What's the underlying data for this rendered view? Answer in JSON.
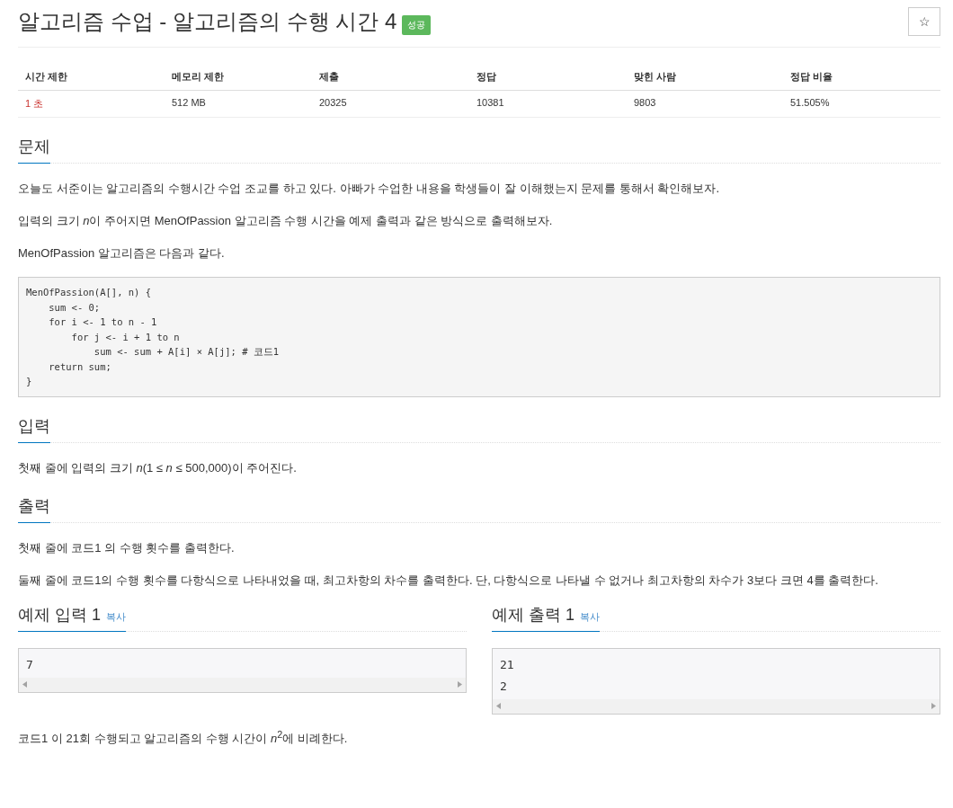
{
  "title": "알고리즘 수업 - 알고리즘의 수행 시간 4",
  "badge": "성공",
  "star_button": "☆",
  "info_table": {
    "columns": [
      "시간 제한",
      "메모리 제한",
      "제출",
      "정답",
      "맞힌 사람",
      "정답 비율"
    ],
    "row": [
      "1 초",
      "512 MB",
      "20325",
      "10381",
      "9803",
      "51.505%"
    ]
  },
  "sections": [
    {
      "heading": "문제",
      "blocks": [
        {
          "kind": "text",
          "text": "오늘도 서준이는 알고리즘의 수행시간 수업 조교를 하고 있다. 아빠가 수업한 내용을 학생들이 잘 이해했는지 문제를 통해서 확인해보자."
        },
        {
          "kind": "runs",
          "runs": [
            {
              "text": "입력의 크기 ",
              "italic": false
            },
            {
              "text": "n",
              "italic": true
            },
            {
              "text": "이 주어지면 MenOfPassion 알고리즘 수행 시간을 예제 출력과 같은 방식으로 출력해보자.",
              "italic": false
            }
          ]
        },
        {
          "kind": "text",
          "text": "MenOfPassion 알고리즘은 다음과 같다."
        },
        {
          "kind": "code",
          "lines": [
            "MenOfPassion(A[], n) {",
            "    sum <- 0;",
            "    for i <- 1 to n - 1",
            "        for j <- i + 1 to n",
            "            sum <- sum + A[i] × A[j]; # 코드1",
            "    return sum;",
            "}"
          ]
        }
      ]
    },
    {
      "heading": "입력",
      "blocks": [
        {
          "kind": "text",
          "text": "첫째 줄에 입력의 크기 *n*(1 ≤ *n* ≤ 500,000)이 주어진다."
        }
      ]
    },
    {
      "heading": "출력",
      "blocks": [
        {
          "kind": "text",
          "text": "첫째 줄에 코드1 의 수행 횟수를 출력한다."
        },
        {
          "kind": "text",
          "text": "둘째 줄에 코드1의 수행 횟수를 다항식으로 나타내었을 때, 최고차항의 차수를 출력한다. 단, 다항식으로 나타낼 수 없거나 최고차항의 차수가 3보다 크면 4를 출력한다."
        }
      ]
    }
  ],
  "samples": [
    {
      "heading": "예제 입력 1",
      "copy": "복사",
      "lines": [
        "7"
      ]
    },
    {
      "heading": "예제 출력 1",
      "copy": "복사",
      "lines": [
        "21",
        "2"
      ]
    }
  ],
  "note": "코드1 이 21회 수행되고 알고리즘의 수행 시간이 *n*$^{2}$에 비례한다."
}
